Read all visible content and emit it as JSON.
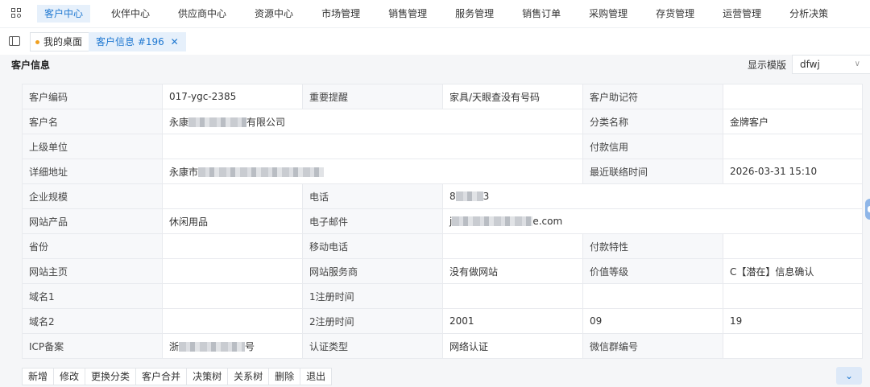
{
  "nav": {
    "items": [
      "客户中心",
      "伙伴中心",
      "供应商中心",
      "资源中心",
      "市场管理",
      "销售管理",
      "服务管理",
      "销售订单",
      "采购管理",
      "存货管理",
      "运营管理",
      "分析决策"
    ],
    "active_index": 0
  },
  "tabs": {
    "home_label": "我的桌面",
    "customer_label": "客户信息 #196",
    "close_glyph": "✕"
  },
  "section": {
    "title": "客户信息",
    "template_label": "显示模版",
    "template_value": "dfwj"
  },
  "fields": {
    "code_label": "客户编码",
    "code_value": "017-ygc-2385",
    "reminder_label": "重要提醒",
    "reminder_value": "家具/天眼查没有号码",
    "mnemonic_label": "客户助记符",
    "mnemonic_value": "",
    "name_label": "客户名",
    "name_prefix": "永康",
    "name_suffix": "有限公司",
    "category_label": "分类名称",
    "category_value": "金牌客户",
    "parent_label": "上级单位",
    "parent_value": "",
    "credit_label": "付款信用",
    "credit_value": "",
    "address_label": "详细地址",
    "address_prefix": "永康市",
    "last_contact_label": "最近联络时间",
    "last_contact_value": "2026-03-31 15:10",
    "scale_label": "企业规模",
    "scale_value": "",
    "phone_label": "电话",
    "phone_prefix": "8",
    "phone_suffix": "3",
    "product_label": "网站产品",
    "product_value": "休闲用品",
    "email_label": "电子邮件",
    "email_prefix": "j",
    "email_suffix": "e.com",
    "province_label": "省份",
    "province_value": "",
    "mobile_label": "移动电话",
    "mobile_value": "",
    "payment_label": "付款特性",
    "payment_value": "",
    "homepage_label": "网站主页",
    "homepage_value": "",
    "provider_label": "网站服务商",
    "provider_value": "没有做网站",
    "value_level_label": "价值等级",
    "value_level_value": "C【潜在】信息确认",
    "domain1_label": "域名1",
    "domain1_value": "",
    "reg1_label": "1注册时间",
    "reg1_value": "",
    "domain2_label": "域名2",
    "domain2_value": "",
    "reg2_label": "2注册时间",
    "reg2_year": "2001",
    "reg2_month": "09",
    "reg2_day": "19",
    "icp_label": "ICP备案",
    "icp_prefix": "浙",
    "icp_suffix": "号",
    "cert_label": "认证类型",
    "cert_value": "网络认证",
    "wechat_label": "微信群编号",
    "wechat_value": ""
  },
  "actions": [
    "新增",
    "修改",
    "更换分类",
    "客户合并",
    "决策树",
    "关系树",
    "删除",
    "退出"
  ],
  "expand_glyph": "⌄",
  "colors": {
    "accent": "#1f78d1",
    "active_bg": "#e6f0fb",
    "label_bg": "#f7f8fa"
  }
}
